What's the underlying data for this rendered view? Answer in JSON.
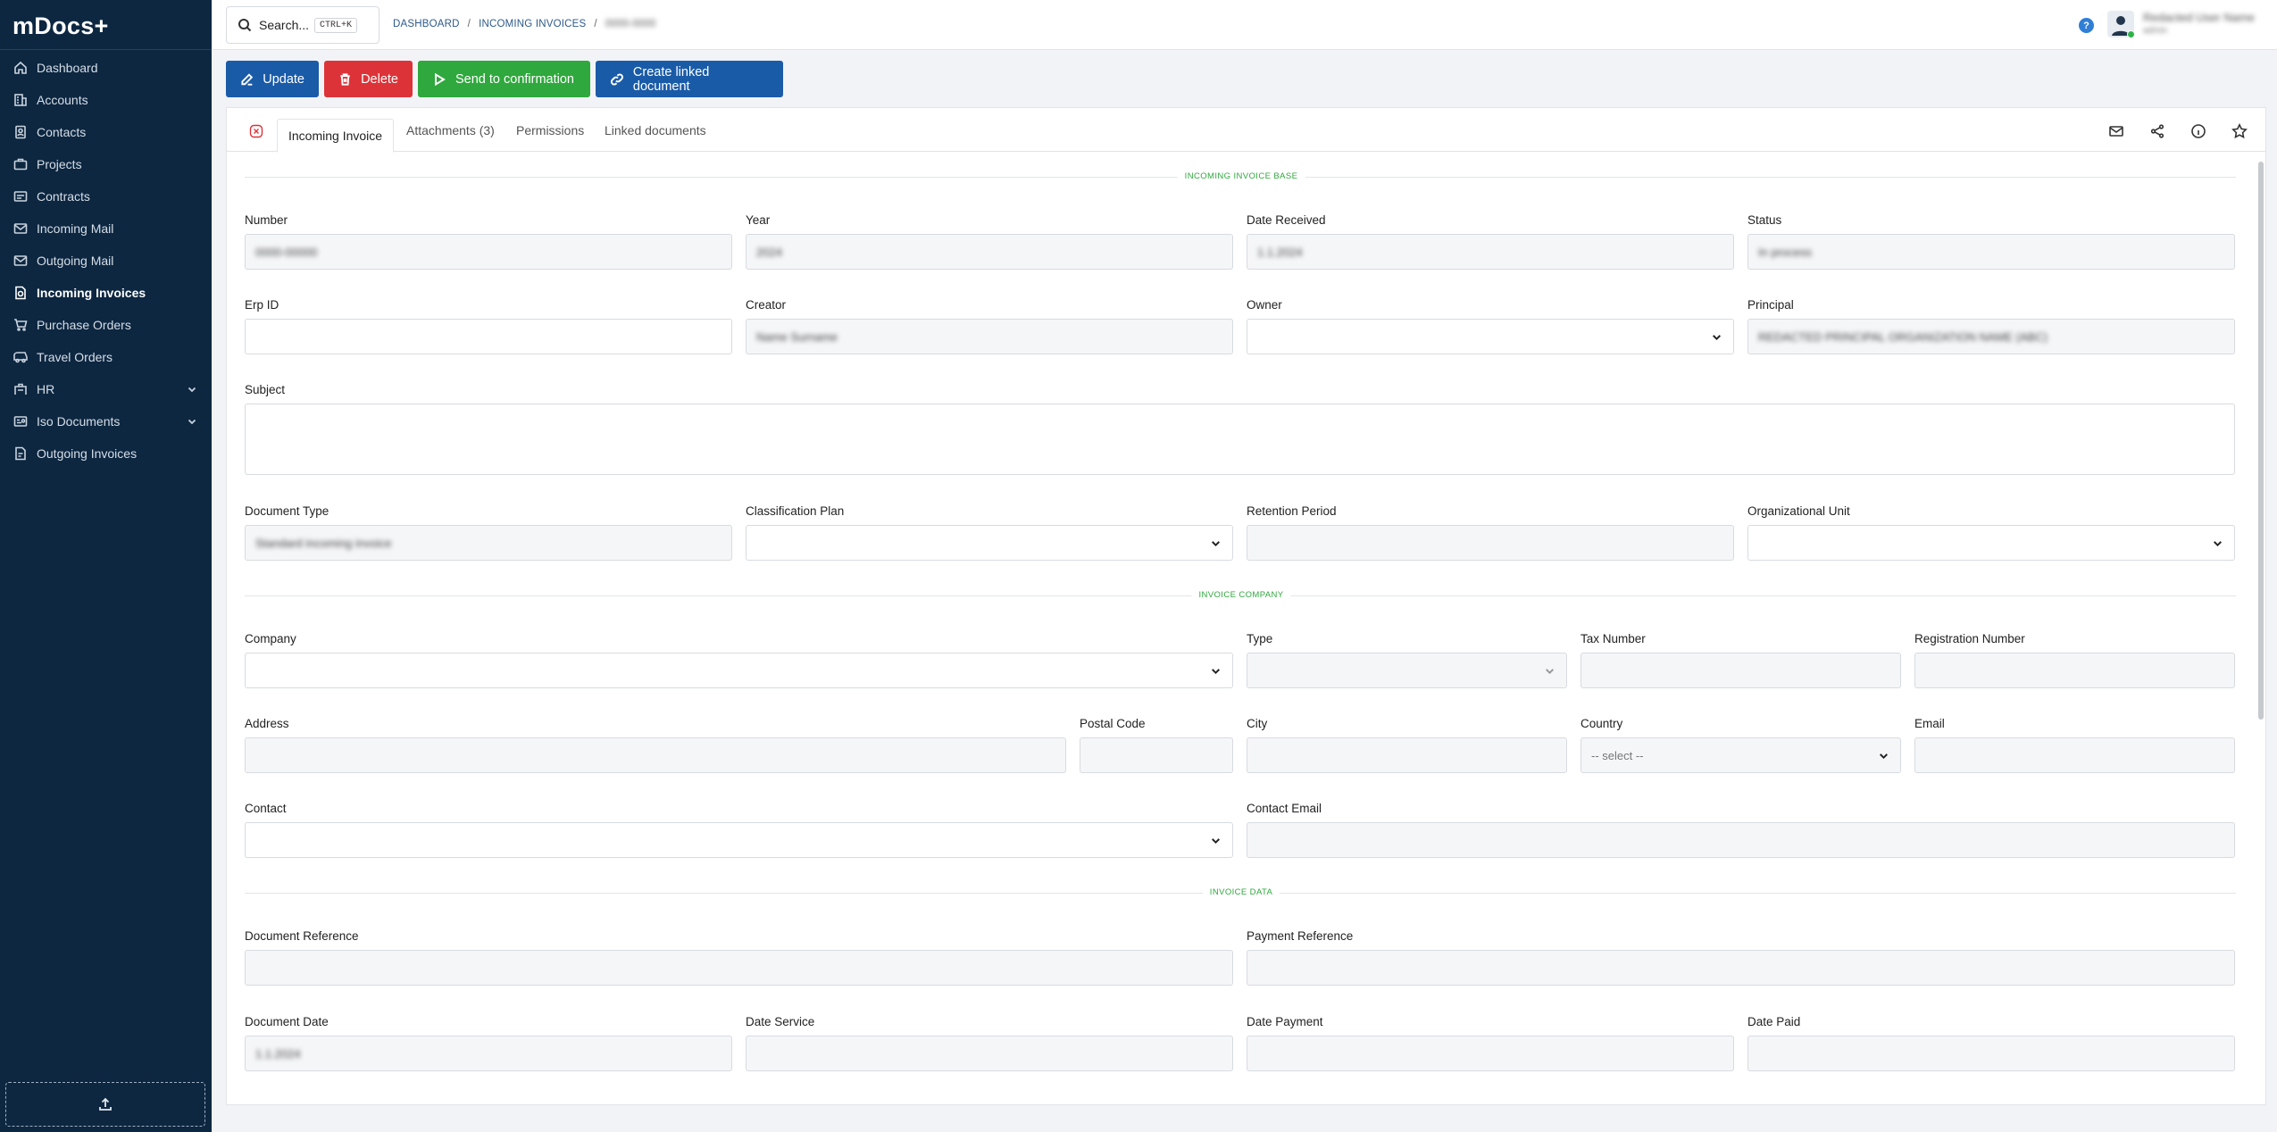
{
  "app": {
    "title": "mDocs+"
  },
  "sidebar": {
    "items": [
      {
        "label": "Dashboard",
        "icon": "home-icon"
      },
      {
        "label": "Accounts",
        "icon": "building-icon"
      },
      {
        "label": "Contacts",
        "icon": "contacts-icon"
      },
      {
        "label": "Projects",
        "icon": "briefcase-icon"
      },
      {
        "label": "Contracts",
        "icon": "contract-icon"
      },
      {
        "label": "Incoming Mail",
        "icon": "mail-in-icon"
      },
      {
        "label": "Outgoing Mail",
        "icon": "mail-out-icon"
      },
      {
        "label": "Incoming Invoices",
        "icon": "invoice-icon",
        "active": true
      },
      {
        "label": "Purchase Orders",
        "icon": "cart-icon"
      },
      {
        "label": "Travel Orders",
        "icon": "bus-icon"
      },
      {
        "label": "HR",
        "icon": "hr-icon",
        "expandable": true
      },
      {
        "label": "Iso Documents",
        "icon": "iso-icon",
        "expandable": true
      },
      {
        "label": "Outgoing Invoices",
        "icon": "invoice-out-icon"
      }
    ]
  },
  "topbar": {
    "search_label": "Search...",
    "search_shortcut": "CTRL+K",
    "breadcrumb": [
      "DASHBOARD",
      "INCOMING INVOICES",
      "0000-0000"
    ],
    "help": "?",
    "user_name": "Redacted User Name",
    "user_role": "admin"
  },
  "actions": {
    "update": "Update",
    "delete": "Delete",
    "send": "Send to confirmation",
    "link": "Create linked document"
  },
  "tabs": [
    "Incoming Invoice",
    "Attachments (3)",
    "Permissions",
    "Linked documents"
  ],
  "sections": {
    "base": "INCOMING INVOICE BASE",
    "company": "INVOICE COMPANY",
    "data": "INVOICE DATA"
  },
  "fields": {
    "number": {
      "label": "Number",
      "value": "0000-00000"
    },
    "year": {
      "label": "Year",
      "value": "2024"
    },
    "date_received": {
      "label": "Date Received",
      "value": "1.1.2024"
    },
    "status": {
      "label": "Status",
      "value": "In process"
    },
    "erp_id": {
      "label": "Erp ID",
      "value": ""
    },
    "creator": {
      "label": "Creator",
      "value": "Name Surname"
    },
    "owner": {
      "label": "Owner",
      "value": ""
    },
    "principal": {
      "label": "Principal",
      "value": "REDACTED PRINCIPAL ORGANIZATION NAME (ABC)"
    },
    "subject": {
      "label": "Subject",
      "value": ""
    },
    "document_type": {
      "label": "Document Type",
      "value": "Standard incoming invoice"
    },
    "classification_plan": {
      "label": "Classification Plan",
      "value": ""
    },
    "retention_period": {
      "label": "Retention Period",
      "value": ""
    },
    "org_unit": {
      "label": "Organizational Unit",
      "value": ""
    },
    "company": {
      "label": "Company",
      "value": ""
    },
    "type": {
      "label": "Type",
      "value": ""
    },
    "tax_number": {
      "label": "Tax Number",
      "value": ""
    },
    "registration_number": {
      "label": "Registration Number",
      "value": ""
    },
    "address": {
      "label": "Address",
      "value": ""
    },
    "postal_code": {
      "label": "Postal Code",
      "value": ""
    },
    "city": {
      "label": "City",
      "value": ""
    },
    "country": {
      "label": "Country",
      "value": "-- select --"
    },
    "email": {
      "label": "Email",
      "value": ""
    },
    "contact": {
      "label": "Contact",
      "value": ""
    },
    "contact_email": {
      "label": "Contact Email",
      "value": ""
    },
    "document_reference": {
      "label": "Document Reference",
      "value": ""
    },
    "payment_reference": {
      "label": "Payment Reference",
      "value": ""
    },
    "document_date": {
      "label": "Document Date",
      "value": "1.1.2024"
    },
    "date_service": {
      "label": "Date Service",
      "value": ""
    },
    "date_payment": {
      "label": "Date Payment",
      "value": ""
    },
    "date_paid": {
      "label": "Date Paid",
      "value": ""
    }
  },
  "colors": {
    "sidebar_bg": "#0d2741",
    "primary": "#1a5ba8",
    "danger": "#dc3339",
    "success": "#2fa83d"
  }
}
